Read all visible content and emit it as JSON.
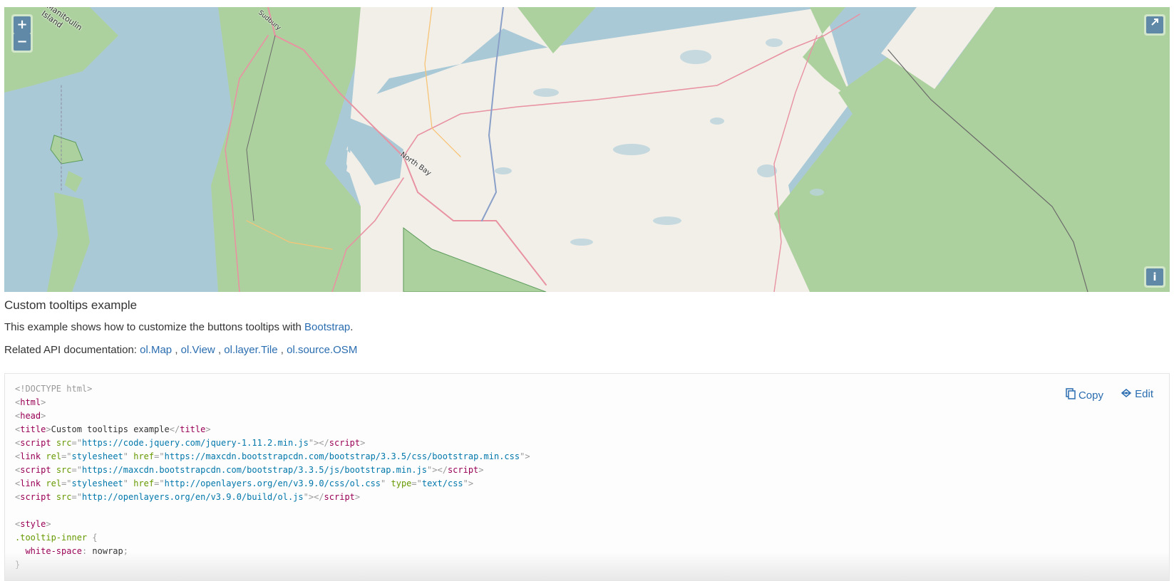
{
  "map": {
    "zoom_in_label": "+",
    "zoom_out_label": "−",
    "rotate_icon": "rotate-arrow-icon",
    "attribution_label": "i",
    "place_labels": [
      "Manitoulin\nIsland",
      "North Bay",
      "Sudbury"
    ],
    "colors": {
      "water": "#aac9d6",
      "forest": "#add19e",
      "land": "#f2efe9",
      "road_major": "#e892a2",
      "road_secondary": "#f7c476",
      "boundary": "#6a6a6a"
    }
  },
  "page": {
    "title": "Custom tooltips example",
    "desc_prefix": "This example shows how to customize the buttons tooltips with ",
    "desc_link": "Bootstrap",
    "desc_suffix": ".",
    "related_label": "Related API documentation: ",
    "api_links": [
      "ol.Map",
      "ol.View",
      "ol.layer.Tile",
      "ol.source.OSM"
    ],
    "api_separator": ","
  },
  "code_panel": {
    "copy_label": "Copy",
    "edit_label": "Edit",
    "copy_icon": "clipboard-icon",
    "edit_icon": "codepen-icon",
    "lines": [
      [
        [
          "punc",
          "<!DOCTYPE html>"
        ]
      ],
      [
        [
          "punc",
          "<"
        ],
        [
          "tag",
          "html"
        ],
        [
          "punc",
          ">"
        ]
      ],
      [
        [
          "punc",
          "<"
        ],
        [
          "tag",
          "head"
        ],
        [
          "punc",
          ">"
        ]
      ],
      [
        [
          "punc",
          "<"
        ],
        [
          "tag",
          "title"
        ],
        [
          "punc",
          ">"
        ],
        [
          "plain",
          "Custom tooltips example"
        ],
        [
          "punc",
          "</"
        ],
        [
          "tag",
          "title"
        ],
        [
          "punc",
          ">"
        ]
      ],
      [
        [
          "punc",
          "<"
        ],
        [
          "tag",
          "script"
        ],
        [
          "plain",
          " "
        ],
        [
          "attr",
          "src"
        ],
        [
          "punc",
          "=\""
        ],
        [
          "val",
          "https://code.jquery.com/jquery-1.11.2.min.js"
        ],
        [
          "punc",
          "\"></"
        ],
        [
          "tag",
          "script"
        ],
        [
          "punc",
          ">"
        ]
      ],
      [
        [
          "punc",
          "<"
        ],
        [
          "tag",
          "link"
        ],
        [
          "plain",
          " "
        ],
        [
          "attr",
          "rel"
        ],
        [
          "punc",
          "=\""
        ],
        [
          "val",
          "stylesheet"
        ],
        [
          "punc",
          "\""
        ],
        [
          "plain",
          " "
        ],
        [
          "attr",
          "href"
        ],
        [
          "punc",
          "=\""
        ],
        [
          "val",
          "https://maxcdn.bootstrapcdn.com/bootstrap/3.3.5/css/bootstrap.min.css"
        ],
        [
          "punc",
          "\">"
        ]
      ],
      [
        [
          "punc",
          "<"
        ],
        [
          "tag",
          "script"
        ],
        [
          "plain",
          " "
        ],
        [
          "attr",
          "src"
        ],
        [
          "punc",
          "=\""
        ],
        [
          "val",
          "https://maxcdn.bootstrapcdn.com/bootstrap/3.3.5/js/bootstrap.min.js"
        ],
        [
          "punc",
          "\"></"
        ],
        [
          "tag",
          "script"
        ],
        [
          "punc",
          ">"
        ]
      ],
      [
        [
          "punc",
          "<"
        ],
        [
          "tag",
          "link"
        ],
        [
          "plain",
          " "
        ],
        [
          "attr",
          "rel"
        ],
        [
          "punc",
          "=\""
        ],
        [
          "val",
          "stylesheet"
        ],
        [
          "punc",
          "\""
        ],
        [
          "plain",
          " "
        ],
        [
          "attr",
          "href"
        ],
        [
          "punc",
          "=\""
        ],
        [
          "val",
          "http://openlayers.org/en/v3.9.0/css/ol.css"
        ],
        [
          "punc",
          "\""
        ],
        [
          "plain",
          " "
        ],
        [
          "attr",
          "type"
        ],
        [
          "punc",
          "=\""
        ],
        [
          "val",
          "text/css"
        ],
        [
          "punc",
          "\">"
        ]
      ],
      [
        [
          "punc",
          "<"
        ],
        [
          "tag",
          "script"
        ],
        [
          "plain",
          " "
        ],
        [
          "attr",
          "src"
        ],
        [
          "punc",
          "=\""
        ],
        [
          "val",
          "http://openlayers.org/en/v3.9.0/build/ol.js"
        ],
        [
          "punc",
          "\"></"
        ],
        [
          "tag",
          "script"
        ],
        [
          "punc",
          ">"
        ]
      ],
      [],
      [
        [
          "punc",
          "<"
        ],
        [
          "tag",
          "style"
        ],
        [
          "punc",
          ">"
        ]
      ],
      [
        [
          "sel",
          ".tooltip-inner"
        ],
        [
          "plain",
          " "
        ],
        [
          "punc",
          "{"
        ]
      ],
      [
        [
          "plain",
          "  "
        ],
        [
          "prop",
          "white-space"
        ],
        [
          "punc",
          ":"
        ],
        [
          "plain",
          " nowrap"
        ],
        [
          "punc",
          ";"
        ]
      ],
      [
        [
          "punc",
          "}"
        ]
      ]
    ]
  }
}
